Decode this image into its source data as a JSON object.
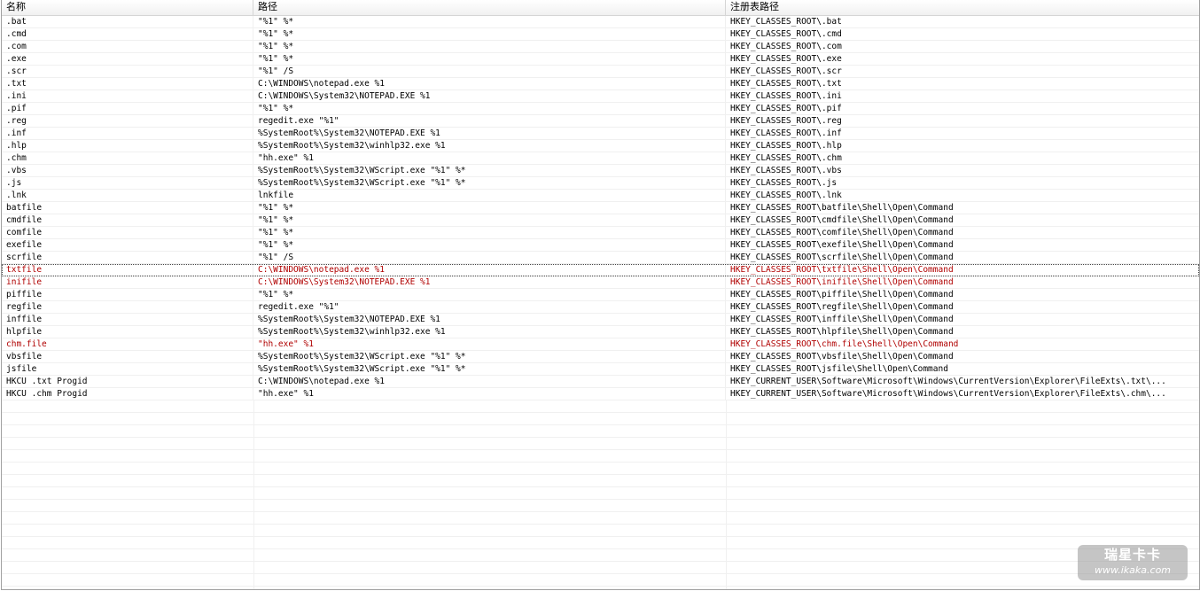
{
  "columns": {
    "name": "名称",
    "path": "路径",
    "registry": "注册表路径"
  },
  "rows": [
    {
      "name": ".bat",
      "path": "\"%1\" %*",
      "registry": "HKEY_CLASSES_ROOT\\.bat",
      "highlight": false
    },
    {
      "name": ".cmd",
      "path": "\"%1\" %*",
      "registry": "HKEY_CLASSES_ROOT\\.cmd",
      "highlight": false
    },
    {
      "name": ".com",
      "path": "\"%1\" %*",
      "registry": "HKEY_CLASSES_ROOT\\.com",
      "highlight": false
    },
    {
      "name": ".exe",
      "path": "\"%1\" %*",
      "registry": "HKEY_CLASSES_ROOT\\.exe",
      "highlight": false
    },
    {
      "name": ".scr",
      "path": "\"%1\" /S",
      "registry": "HKEY_CLASSES_ROOT\\.scr",
      "highlight": false
    },
    {
      "name": ".txt",
      "path": "C:\\WINDOWS\\notepad.exe %1",
      "registry": "HKEY_CLASSES_ROOT\\.txt",
      "highlight": false
    },
    {
      "name": ".ini",
      "path": "C:\\WINDOWS\\System32\\NOTEPAD.EXE %1",
      "registry": "HKEY_CLASSES_ROOT\\.ini",
      "highlight": false
    },
    {
      "name": ".pif",
      "path": "\"%1\" %*",
      "registry": "HKEY_CLASSES_ROOT\\.pif",
      "highlight": false
    },
    {
      "name": ".reg",
      "path": "regedit.exe \"%1\"",
      "registry": "HKEY_CLASSES_ROOT\\.reg",
      "highlight": false
    },
    {
      "name": ".inf",
      "path": "%SystemRoot%\\System32\\NOTEPAD.EXE %1",
      "registry": "HKEY_CLASSES_ROOT\\.inf",
      "highlight": false
    },
    {
      "name": ".hlp",
      "path": "%SystemRoot%\\System32\\winhlp32.exe %1",
      "registry": "HKEY_CLASSES_ROOT\\.hlp",
      "highlight": false
    },
    {
      "name": ".chm",
      "path": "\"hh.exe\" %1",
      "registry": "HKEY_CLASSES_ROOT\\.chm",
      "highlight": false
    },
    {
      "name": ".vbs",
      "path": "%SystemRoot%\\System32\\WScript.exe \"%1\" %*",
      "registry": "HKEY_CLASSES_ROOT\\.vbs",
      "highlight": false
    },
    {
      "name": ".js",
      "path": "%SystemRoot%\\System32\\WScript.exe \"%1\" %*",
      "registry": "HKEY_CLASSES_ROOT\\.js",
      "highlight": false
    },
    {
      "name": ".lnk",
      "path": "lnkfile",
      "registry": "HKEY_CLASSES_ROOT\\.lnk",
      "highlight": false
    },
    {
      "name": "batfile",
      "path": "\"%1\" %*",
      "registry": "HKEY_CLASSES_ROOT\\batfile\\Shell\\Open\\Command",
      "highlight": false
    },
    {
      "name": "cmdfile",
      "path": "\"%1\" %*",
      "registry": "HKEY_CLASSES_ROOT\\cmdfile\\Shell\\Open\\Command",
      "highlight": false
    },
    {
      "name": "comfile",
      "path": "\"%1\" %*",
      "registry": "HKEY_CLASSES_ROOT\\comfile\\Shell\\Open\\Command",
      "highlight": false
    },
    {
      "name": "exefile",
      "path": "\"%1\" %*",
      "registry": "HKEY_CLASSES_ROOT\\exefile\\Shell\\Open\\Command",
      "highlight": false
    },
    {
      "name": "scrfile",
      "path": "\"%1\" /S",
      "registry": "HKEY_CLASSES_ROOT\\scrfile\\Shell\\Open\\Command",
      "highlight": false
    },
    {
      "name": "txtfile",
      "path": "C:\\WINDOWS\\notepad.exe %1",
      "registry": "HKEY_CLASSES_ROOT\\txtfile\\Shell\\Open\\Command",
      "highlight": true,
      "selected": true
    },
    {
      "name": "inifile",
      "path": "C:\\WINDOWS\\System32\\NOTEPAD.EXE %1",
      "registry": "HKEY_CLASSES_ROOT\\inifile\\Shell\\Open\\Command",
      "highlight": true
    },
    {
      "name": "piffile",
      "path": "\"%1\" %*",
      "registry": "HKEY_CLASSES_ROOT\\piffile\\Shell\\Open\\Command",
      "highlight": false
    },
    {
      "name": "regfile",
      "path": "regedit.exe \"%1\"",
      "registry": "HKEY_CLASSES_ROOT\\regfile\\Shell\\Open\\Command",
      "highlight": false
    },
    {
      "name": "inffile",
      "path": "%SystemRoot%\\System32\\NOTEPAD.EXE %1",
      "registry": "HKEY_CLASSES_ROOT\\inffile\\Shell\\Open\\Command",
      "highlight": false
    },
    {
      "name": "hlpfile",
      "path": "%SystemRoot%\\System32\\winhlp32.exe %1",
      "registry": "HKEY_CLASSES_ROOT\\hlpfile\\Shell\\Open\\Command",
      "highlight": false
    },
    {
      "name": "chm.file",
      "path": "\"hh.exe\" %1",
      "registry": "HKEY_CLASSES_ROOT\\chm.file\\Shell\\Open\\Command",
      "highlight": true
    },
    {
      "name": "vbsfile",
      "path": "%SystemRoot%\\System32\\WScript.exe \"%1\" %*",
      "registry": "HKEY_CLASSES_ROOT\\vbsfile\\Shell\\Open\\Command",
      "highlight": false
    },
    {
      "name": "jsfile",
      "path": "%SystemRoot%\\System32\\WScript.exe \"%1\" %*",
      "registry": "HKEY_CLASSES_ROOT\\jsfile\\Shell\\Open\\Command",
      "highlight": false
    },
    {
      "name": "HKCU .txt Progid",
      "path": "C:\\WINDOWS\\notepad.exe %1",
      "registry": "HKEY_CURRENT_USER\\Software\\Microsoft\\Windows\\CurrentVersion\\Explorer\\FileExts\\.txt\\...",
      "highlight": false
    },
    {
      "name": "HKCU .chm Progid",
      "path": "\"hh.exe\" %1",
      "registry": "HKEY_CURRENT_USER\\Software\\Microsoft\\Windows\\CurrentVersion\\Explorer\\FileExts\\.chm\\...",
      "highlight": false
    }
  ],
  "colors": {
    "highlight_text": "#b00000",
    "grid_line": "#f0f0f0"
  },
  "watermark": {
    "brand": "瑞星卡卡",
    "url": "www.ikaka.com"
  }
}
